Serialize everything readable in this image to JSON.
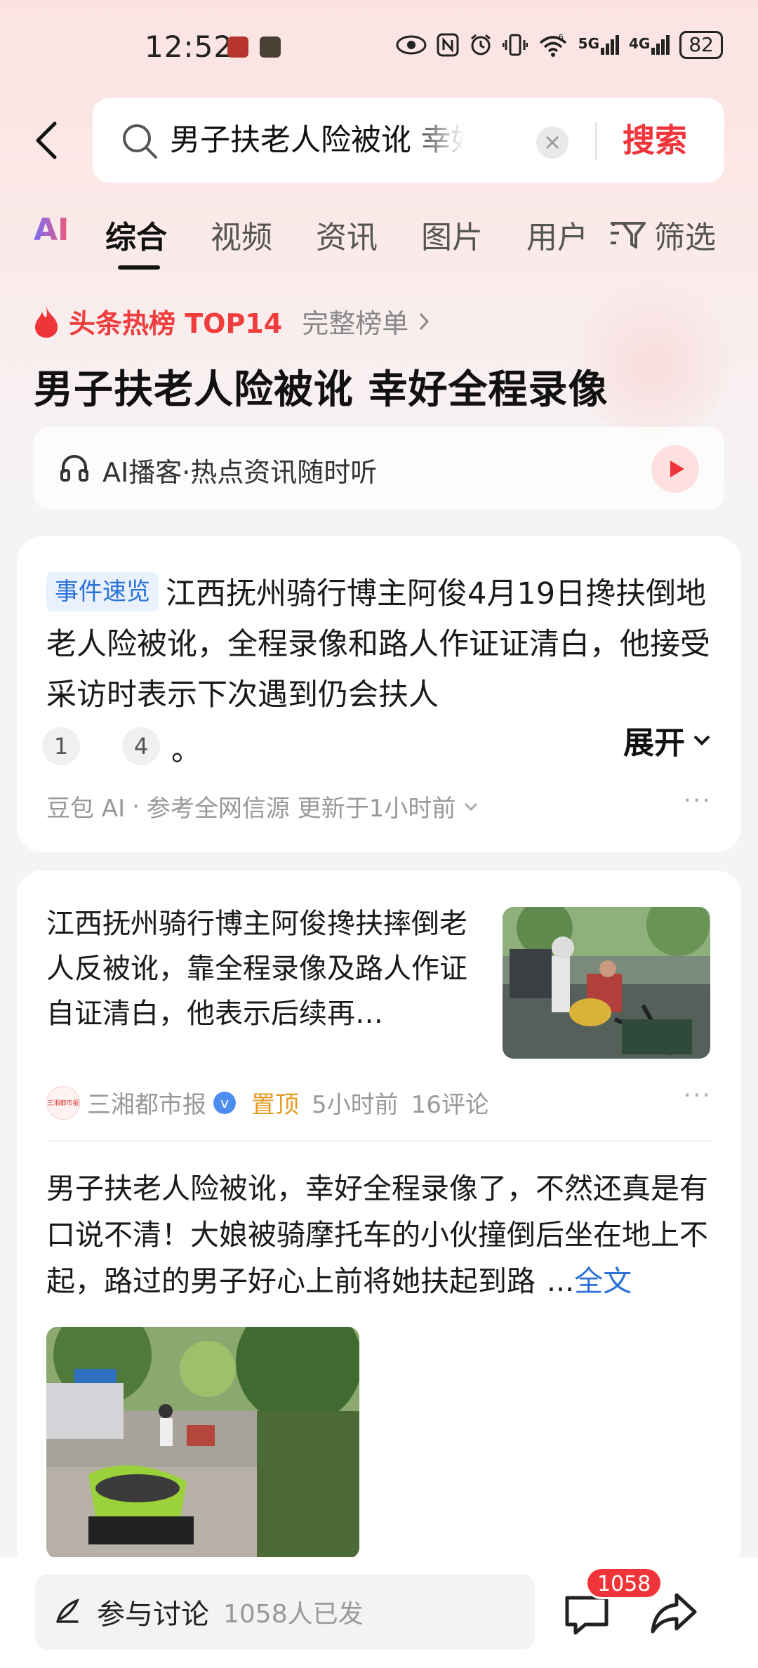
{
  "status_bar": {
    "time": "12:52",
    "battery": "82",
    "net1": "5G",
    "net2": "4G",
    "wifi_badge": "6"
  },
  "search": {
    "query": "男子扶老人险被讹 幸好全程录像",
    "clear_glyph": "×",
    "button_label": "搜索"
  },
  "tabs": {
    "items": [
      "AI",
      "综合",
      "视频",
      "资讯",
      "图片",
      "用户"
    ],
    "active": "综合",
    "filter_label": "筛选"
  },
  "hot": {
    "label": "头条热榜 TOP14",
    "full_list": "完整榜单",
    "headline": "男子扶老人险被讹 幸好全程录像",
    "podcast": "AI播客·热点资讯随时听"
  },
  "summary_card": {
    "tag": "事件速览",
    "text": "江西抚州骑行博主阿俊4月19日搀扶倒地老人险被讹，全程录像和路人作证证清白，他接受采访时表示下次遇到仍会扶人",
    "refs": [
      "1",
      "4"
    ],
    "period": "。",
    "expand_label": "展开",
    "source_prefix": "豆包 AI",
    "source_sep": "·",
    "source_text": "参考全网信源 更新于1小时前",
    "more": "···"
  },
  "news_card": {
    "title": "江西抚州骑行博主阿俊搀扶摔倒老人反被讹，靠全程录像及路人作证自证清白，他表示后续再…",
    "publisher_logo_text": "三湘都市报",
    "publisher": "三湘都市报",
    "verified_glyph": "v",
    "pinned": "置顶",
    "time": "5小时前",
    "comments": "16评论",
    "more": "···"
  },
  "post": {
    "text": "男子扶老人险被讹，幸好全程录像了，不然还真是有口说不清！大娘被骑摩托车的小伙撞倒后坐在地上不起，路过的男子好心上前将她扶起到路",
    "ellipsis": "...",
    "read_full": "全文"
  },
  "bottom_bar": {
    "discuss_label": "参与讨论",
    "discuss_count": "1058人已发",
    "comment_badge": "1058"
  },
  "colors": {
    "accent_red": "#f0353a",
    "link_blue": "#2b71d8",
    "pinned_orange": "#e89b22"
  }
}
